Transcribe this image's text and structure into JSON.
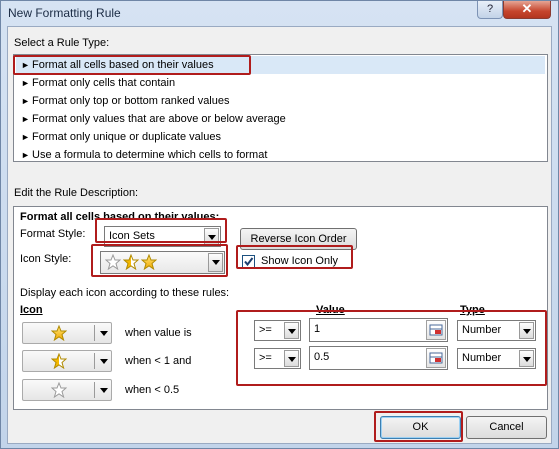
{
  "window": {
    "title": "New Formatting Rule",
    "help_glyph": "?",
    "close_glyph": "✕"
  },
  "rule_type": {
    "label": "Select a Rule Type:",
    "items": [
      "Format all cells based on their values",
      "Format only cells that contain",
      "Format only top or bottom ranked values",
      "Format only values that are above or below average",
      "Format only unique or duplicate values",
      "Use a formula to determine which cells to format"
    ],
    "selected_index": 0,
    "arrow_glyph": "►"
  },
  "description": {
    "label": "Edit the Rule Description:",
    "heading": "Format all cells based on their values:",
    "format_style_label": "Format Style:",
    "format_style_value": "Icon Sets",
    "reverse_button": "Reverse Icon Order",
    "icon_style_label": "Icon Style:",
    "icon_style_value": "3 Stars",
    "show_icon_only_label": "Show Icon Only",
    "show_icon_only_checked": true,
    "rules_caption": "Display each icon according to these rules:",
    "icon_col": "Icon",
    "value_col": "Value",
    "type_col": "Type",
    "rules": [
      {
        "icon": "full-star-icon",
        "condition": "when value is",
        "operator": ">=",
        "value": "1",
        "type": "Number"
      },
      {
        "icon": "half-star-icon",
        "condition": "when < 1 and",
        "operator": ">=",
        "value": "0.5",
        "type": "Number"
      },
      {
        "icon": "empty-star-icon",
        "condition": "when < 0.5",
        "operator": "",
        "value": "",
        "type": ""
      }
    ]
  },
  "buttons": {
    "ok": "OK",
    "cancel": "Cancel"
  },
  "colors": {
    "highlight": "#b01c1c",
    "star_gold": "#f5b800",
    "selection": "#d9e8f7"
  }
}
